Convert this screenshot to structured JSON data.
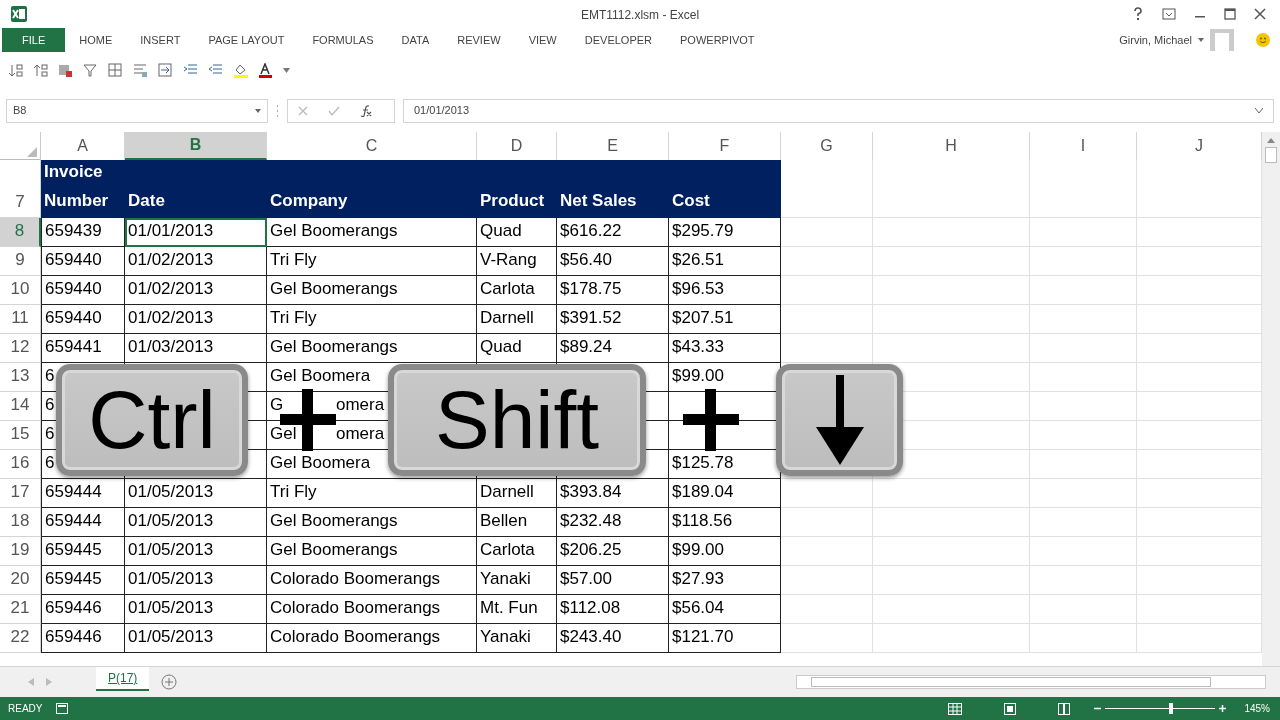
{
  "window": {
    "title": "EMT1112.xlsm - Excel"
  },
  "ribbon_tabs": [
    {
      "label": "FILE",
      "kind": "file",
      "selected": false
    },
    {
      "label": "HOME",
      "kind": "tab",
      "selected": false
    },
    {
      "label": "INSERT",
      "kind": "tab",
      "selected": false
    },
    {
      "label": "PAGE LAYOUT",
      "kind": "tab",
      "selected": false
    },
    {
      "label": "FORMULAS",
      "kind": "tab",
      "selected": false
    },
    {
      "label": "DATA",
      "kind": "tab",
      "selected": false
    },
    {
      "label": "REVIEW",
      "kind": "tab",
      "selected": false
    },
    {
      "label": "VIEW",
      "kind": "tab",
      "selected": false
    },
    {
      "label": "DEVELOPER",
      "kind": "tab",
      "selected": false
    },
    {
      "label": "POWERPIVOT",
      "kind": "tab",
      "selected": false
    }
  ],
  "account": {
    "user": "Girvin, Michael"
  },
  "formula_bar": {
    "name_box": "B8",
    "formula": "01/01/2013"
  },
  "column_headers": [
    {
      "label": "A",
      "selected": false
    },
    {
      "label": "B",
      "selected": true
    },
    {
      "label": "C",
      "selected": false
    },
    {
      "label": "D",
      "selected": false
    },
    {
      "label": "E",
      "selected": false
    },
    {
      "label": "F",
      "selected": false
    },
    {
      "label": "G",
      "selected": false
    },
    {
      "label": "H",
      "selected": false
    },
    {
      "label": "I",
      "selected": false
    },
    {
      "label": "J",
      "selected": false
    }
  ],
  "header_row": {
    "row": "7",
    "cells": {
      "A": "Invoice Number",
      "B": "Date",
      "C": "Company",
      "D": "Product",
      "E": "Net Sales",
      "F": "Cost"
    }
  },
  "rows": [
    {
      "row": "8",
      "selected": true,
      "cells": {
        "A": "659439",
        "B": "01/01/2013",
        "C": "Gel Boomerangs",
        "D": "Quad",
        "E": "$616.22",
        "F": "$295.79"
      }
    },
    {
      "row": "9",
      "selected": false,
      "cells": {
        "A": "659440",
        "B": "01/02/2013",
        "C": "Tri Fly",
        "D": "V-Rang",
        "E": "$56.40",
        "F": "$26.51"
      }
    },
    {
      "row": "10",
      "selected": false,
      "cells": {
        "A": "659440",
        "B": "01/02/2013",
        "C": "Gel Boomerangs",
        "D": "Carlota",
        "E": "$178.75",
        "F": "$96.53"
      }
    },
    {
      "row": "11",
      "selected": false,
      "cells": {
        "A": "659440",
        "B": "01/02/2013",
        "C": "Tri Fly",
        "D": "Darnell",
        "E": "$391.52",
        "F": "$207.51"
      }
    },
    {
      "row": "12",
      "selected": false,
      "cells": {
        "A": "659441",
        "B": "01/03/2013",
        "C": "Gel Boomerangs",
        "D": "Quad",
        "E": "$89.24",
        "F": "$43.33"
      }
    },
    {
      "row": "13",
      "selected": false,
      "cells": {
        "A": "6",
        "C": "Gel Boomera",
        "F": "$99.00"
      }
    },
    {
      "row": "14",
      "selected": false,
      "cells": {
        "A": "6",
        "C": [
          "G",
          "omera"
        ]
      }
    },
    {
      "row": "15",
      "selected": false,
      "cells": {
        "A": "6",
        "C": [
          "Gel",
          "omera"
        ]
      }
    },
    {
      "row": "16",
      "selected": false,
      "cells": {
        "A": "6",
        "C": "Gel Boomera",
        "F": "$125.78"
      }
    },
    {
      "row": "17",
      "selected": false,
      "cells": {
        "A": "659444",
        "B": "01/05/2013",
        "C": "Tri Fly",
        "D": "Darnell",
        "E": "$393.84",
        "F": "$189.04"
      }
    },
    {
      "row": "18",
      "selected": false,
      "cells": {
        "A": "659444",
        "B": "01/05/2013",
        "C": "Gel Boomerangs",
        "D": "Bellen",
        "E": "$232.48",
        "F": "$118.56"
      }
    },
    {
      "row": "19",
      "selected": false,
      "cells": {
        "A": "659445",
        "B": "01/05/2013",
        "C": "Gel Boomerangs",
        "D": "Carlota",
        "E": "$206.25",
        "F": "$99.00"
      }
    },
    {
      "row": "20",
      "selected": false,
      "cells": {
        "A": "659445",
        "B": "01/05/2013",
        "C": "Colorado Boomerangs",
        "D": "Yanaki",
        "E": "$57.00",
        "F": "$27.93"
      }
    },
    {
      "row": "21",
      "selected": false,
      "cells": {
        "A": "659446",
        "B": "01/05/2013",
        "C": "Colorado Boomerangs",
        "D": "Mt. Fun",
        "E": "$112.08",
        "F": "$56.04"
      }
    },
    {
      "row": "22",
      "selected": false,
      "cells": {
        "A": "659446",
        "B": "01/05/2013",
        "C": "Colorado Boomerangs",
        "D": "Yanaki",
        "E": "$243.40",
        "F": "$121.70"
      }
    }
  ],
  "keys": [
    {
      "kind": "key",
      "label": "Ctrl"
    },
    {
      "kind": "plus"
    },
    {
      "kind": "key",
      "label": "Shift"
    },
    {
      "kind": "plus"
    },
    {
      "kind": "arrow_key"
    }
  ],
  "sheet_tabs": [
    {
      "label": "P(17)",
      "selected": true
    }
  ],
  "status_bar": {
    "status": "READY",
    "zoom_slider": {
      "level": 0.6
    },
    "zoom": "145%"
  }
}
